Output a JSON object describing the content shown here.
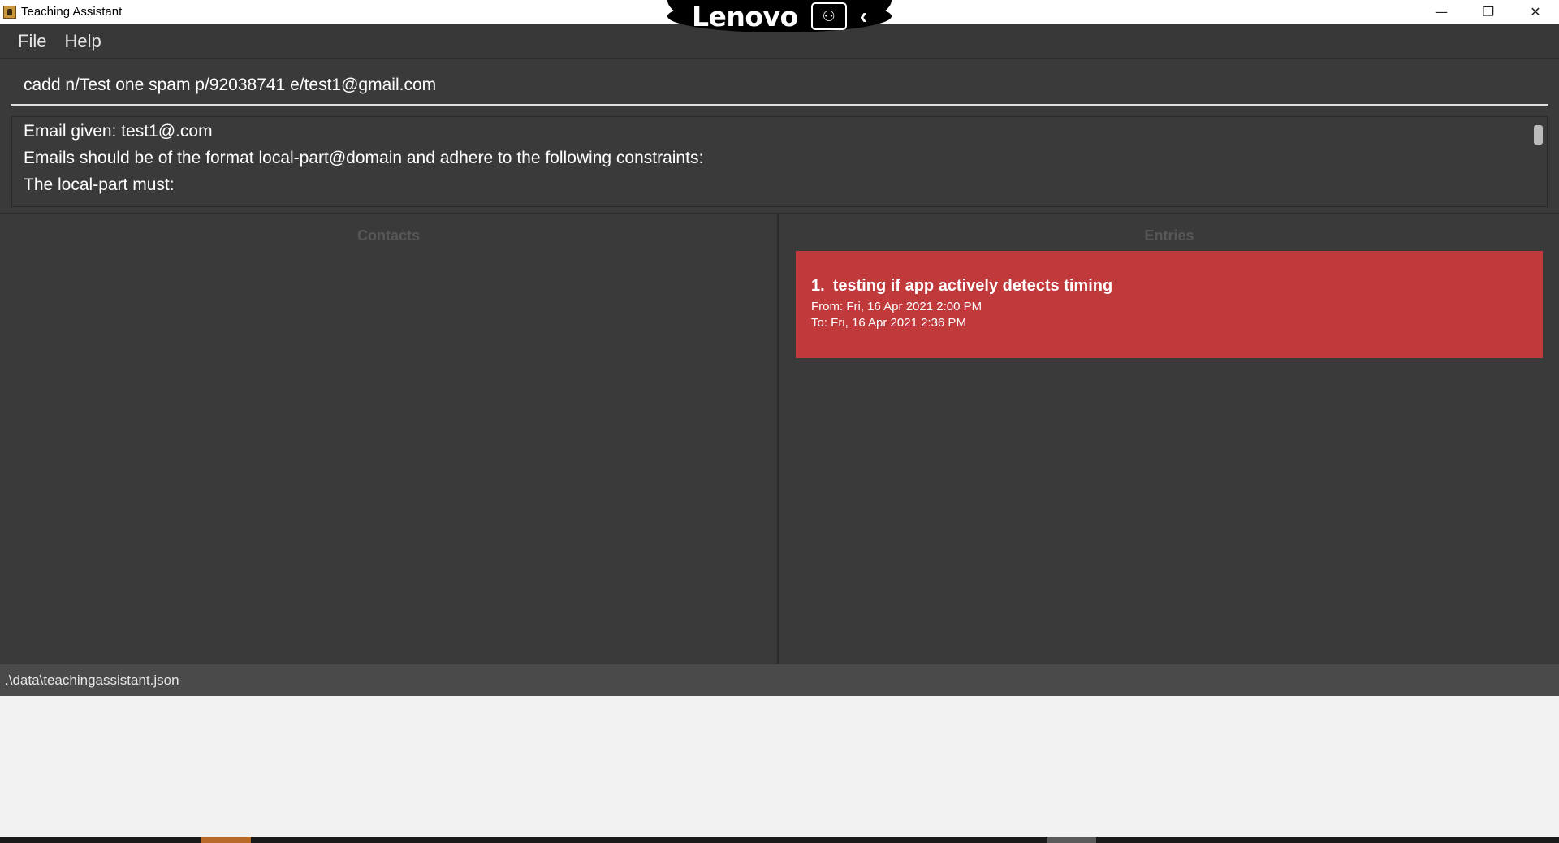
{
  "window": {
    "title": "Teaching Assistant",
    "controls": {
      "minimize": "—",
      "restore": "❐",
      "close": "✕"
    }
  },
  "overlay": {
    "brand": "Lenovo",
    "badge_icon": "presenter-icon",
    "chevron": "‹"
  },
  "menu": {
    "items": [
      {
        "label": "File"
      },
      {
        "label": "Help"
      }
    ]
  },
  "command": {
    "value": "cadd n/Test one spam p/92038741 e/test1@gmail.com"
  },
  "result": {
    "lines": [
      "Email given: test1@.com",
      "Emails should be of the format local-part@domain and adhere to the following constraints:",
      "The local-part must:"
    ]
  },
  "panes": {
    "contacts_title": "Contacts",
    "entries_title": "Entries"
  },
  "entries": [
    {
      "index": "1.",
      "title": "testing if app actively detects timing",
      "from": "From: Fri, 16 Apr 2021 2:00 PM",
      "to": "To: Fri, 16 Apr 2021 2:36 PM",
      "color": "#c0393b"
    }
  ],
  "status": {
    "path": ".\\data\\teachingassistant.json"
  },
  "colors": {
    "app_bg": "#3a3a3a",
    "entry_overdue": "#c0393b",
    "statusbar": "#4a4a4a"
  }
}
